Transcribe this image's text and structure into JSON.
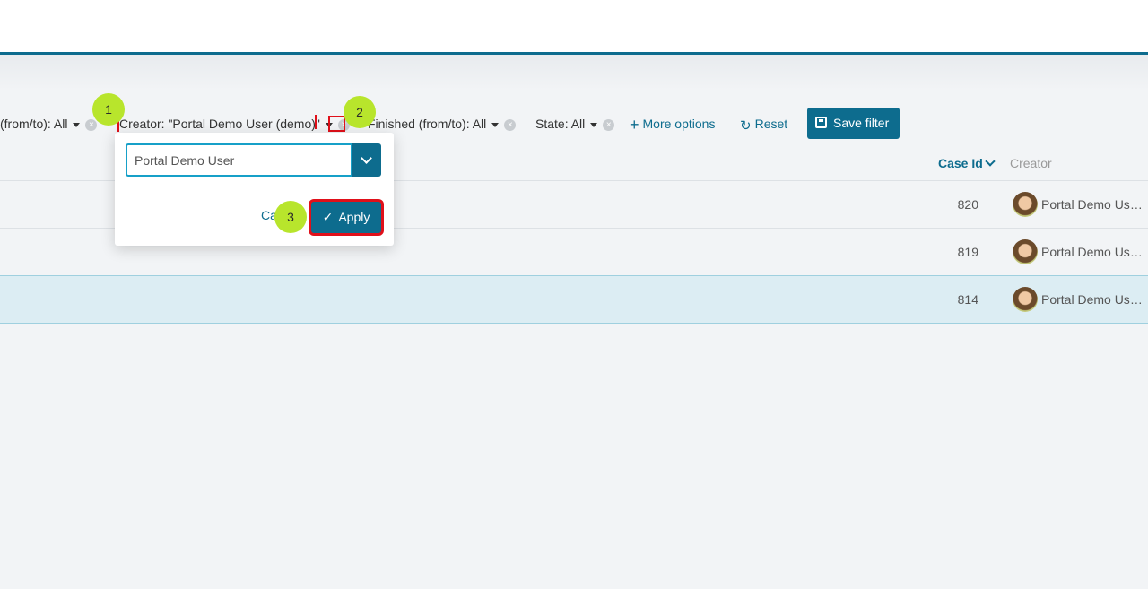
{
  "filters": {
    "created": {
      "label": "(from/to): All"
    },
    "creator": {
      "label": "Creator: \"Portal Demo User (demo)\""
    },
    "finished": {
      "label": "Finished (from/to): All"
    },
    "state": {
      "label": "State: All"
    },
    "more_options": "More options",
    "reset": "Reset",
    "save_filter": "Save filter",
    "clear_symbol": "×"
  },
  "table": {
    "columns": {
      "case_id": "Case Id",
      "creator": "Creator"
    },
    "rows": [
      {
        "id": "820",
        "creator": "Portal Demo User (demo)"
      },
      {
        "id": "819",
        "creator": "Portal Demo User (demo)"
      },
      {
        "id": "814",
        "creator": "Portal Demo User (demo)"
      }
    ],
    "selected_row": "814"
  },
  "popup": {
    "input_value": "Portal Demo User",
    "cancel": "Cancel",
    "apply": "Apply",
    "apply_icon": "✓"
  },
  "annotations": {
    "badge_1": "1",
    "badge_2": "2",
    "badge_3": "3",
    "highlight_color": "#e0101a",
    "badge_color": "#b8e52c"
  },
  "colors": {
    "accent": "#0d6c8e",
    "selected_row": "#dcedf3"
  }
}
